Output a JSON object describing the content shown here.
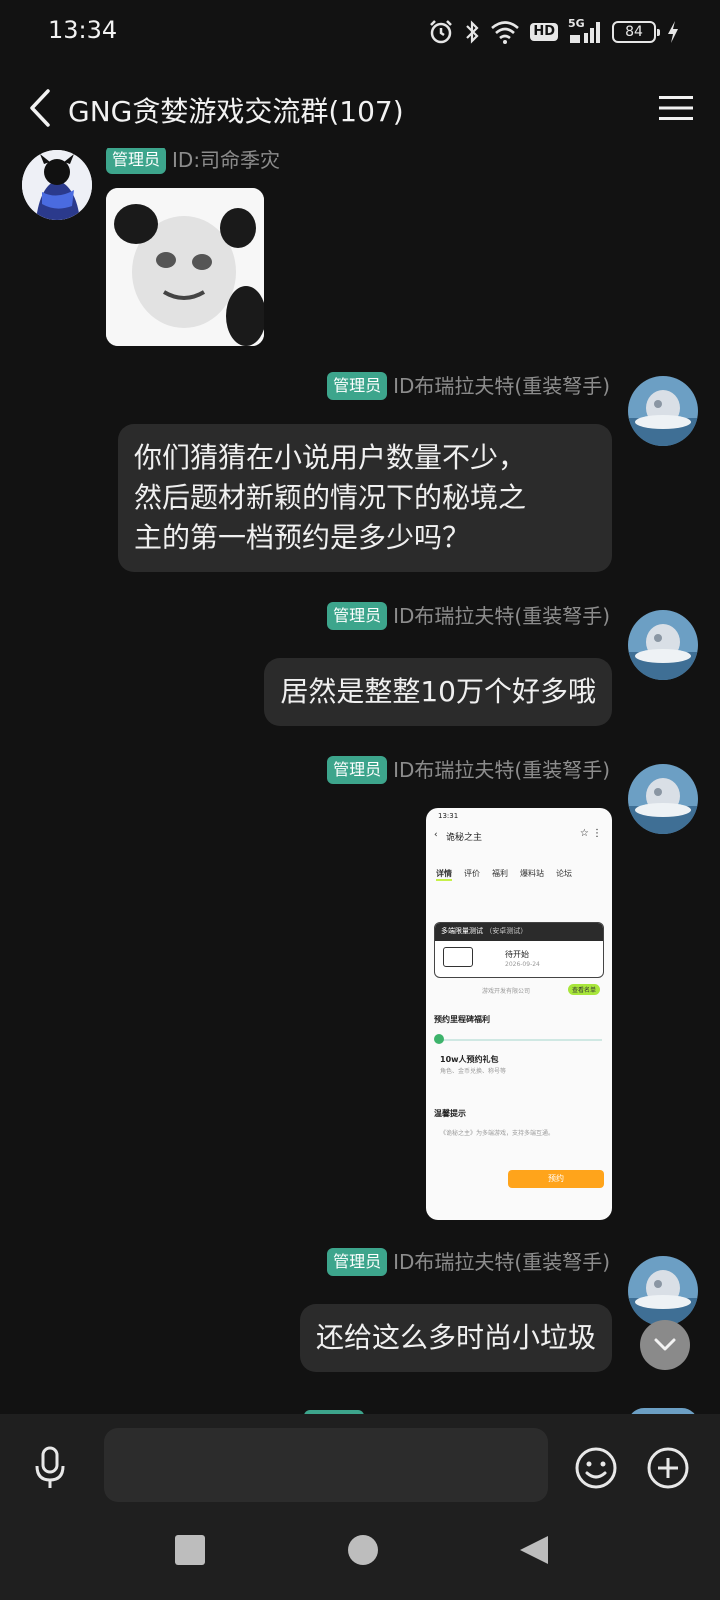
{
  "status_bar": {
    "time": "13:34",
    "network": "5G",
    "hd_label": "HD",
    "battery": "84",
    "icons": [
      "alarm-icon",
      "bluetooth-icon",
      "wifi-icon",
      "hd-icon",
      "signal-icon",
      "battery-icon",
      "charging-icon"
    ]
  },
  "header": {
    "title": "GNG贪婪游戏交流群(107)",
    "back_icon": "chevron-left-icon",
    "menu_icon": "hamburger-menu-icon"
  },
  "messages": [
    {
      "side": "left",
      "badge": "管理员",
      "sender": "ID:司命季灾",
      "type": "image",
      "image": "panda-meme-sticker"
    },
    {
      "side": "right",
      "badge": "管理员",
      "sender": "ID布瑞拉夫特(重装弩手)",
      "type": "text",
      "lines": [
        "你们猜猜在小说用户数量不少，",
        "然后题材新颖的情况下的秘境之",
        "主的第一档预约是多少吗？"
      ]
    },
    {
      "side": "right",
      "badge": "管理员",
      "sender": "ID布瑞拉夫特(重装弩手)",
      "type": "text",
      "text": "居然是整整10万个好多哦"
    },
    {
      "side": "right",
      "badge": "管理员",
      "sender": "ID布瑞拉夫特(重装弩手)",
      "type": "image",
      "image": "game-page-screenshot"
    },
    {
      "side": "right",
      "badge": "管理员",
      "sender": "ID布瑞拉夫特(重装弩手)",
      "type": "text",
      "text": "还给这么多时尚小垃圾"
    }
  ],
  "screenshot": {
    "time": "13:31",
    "title": "诡秘之主",
    "tabs": [
      "详情",
      "评价",
      "福利",
      "爆料站",
      "论坛"
    ],
    "test_title": "多端限量测试",
    "test_sub": "（安卓测试）",
    "status": "待开始",
    "date": "2026-09-24",
    "company": "游戏开发有限公司",
    "view_button": "查看名单",
    "milestone_title": "预约里程碑福利",
    "reward_title": "10w人预约礼包",
    "reward_desc": "角色、金币兑换、称号等",
    "tips_title": "温馨提示",
    "tips_text": "《诡秘之主》为多端游戏，支持多端互通。",
    "reserve_button": "预约"
  },
  "input_bar": {
    "placeholder": "",
    "mic_icon": "microphone-icon",
    "emoji_icon": "emoji-smile-icon",
    "plus_icon": "plus-circle-icon"
  },
  "nav_bar": {
    "icons": [
      "recent-apps-square-icon",
      "home-circle-icon",
      "back-triangle-icon"
    ]
  }
}
